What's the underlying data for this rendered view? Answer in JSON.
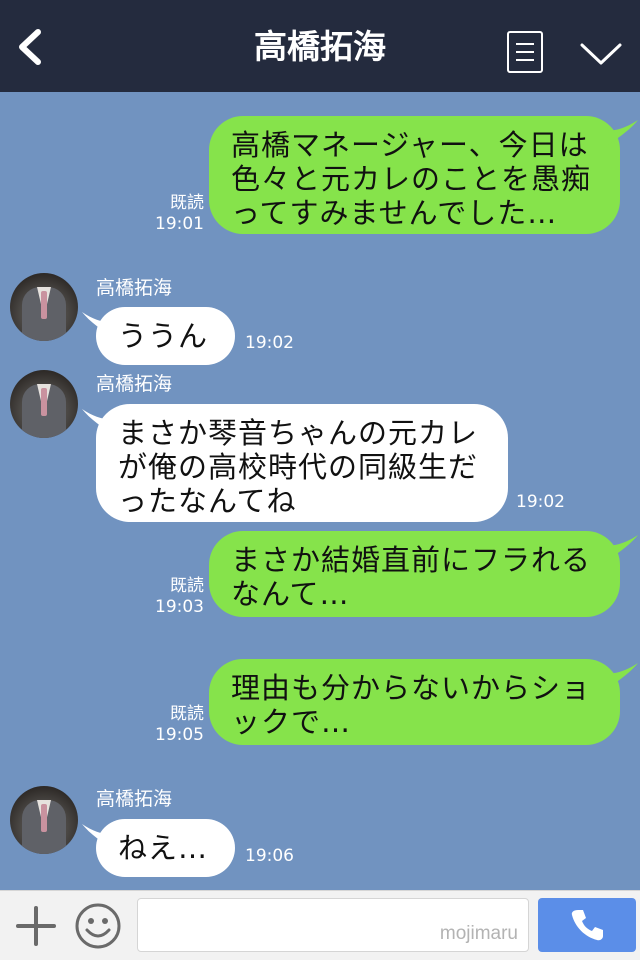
{
  "header": {
    "title": "高橋拓海",
    "back_icon": "chevron-left-icon",
    "menu_icon": "list-icon",
    "more_icon": "chevron-down-icon"
  },
  "messages": [
    {
      "sender": "me",
      "lines": [
        "高橋マネージャー、今日は",
        "色々と元カレのことを愚痴",
        "ってすみませんでした…"
      ],
      "read": "既読",
      "time": "19:01"
    },
    {
      "sender": "them",
      "name": "高橋拓海",
      "lines": [
        "ううん"
      ],
      "time": "19:02"
    },
    {
      "sender": "them",
      "name": "高橋拓海",
      "lines": [
        "まさか琴音ちゃんの元カレ",
        "が俺の高校時代の同級生だ",
        "ったなんてね"
      ],
      "time": "19:02"
    },
    {
      "sender": "me",
      "lines": [
        "まさか結婚直前にフラれる",
        "なんて…"
      ],
      "read": "既読",
      "time": "19:03"
    },
    {
      "sender": "me",
      "lines": [
        "理由も分からないからショ",
        "ックで…"
      ],
      "read": "既読",
      "time": "19:05"
    },
    {
      "sender": "them",
      "name": "高橋拓海",
      "lines": [
        "ねえ…"
      ],
      "time": "19:06"
    }
  ],
  "input_bar": {
    "watermark": "mojimaru",
    "plus_icon": "plus-icon",
    "sticker_icon": "smiley-icon",
    "call_icon": "phone-icon"
  },
  "colors": {
    "header": "#242b3e",
    "chat_bg": "#7193c0",
    "my_bubble": "#86e34b",
    "their_bubble": "#ffffff",
    "call_button": "#5b8ee8"
  }
}
